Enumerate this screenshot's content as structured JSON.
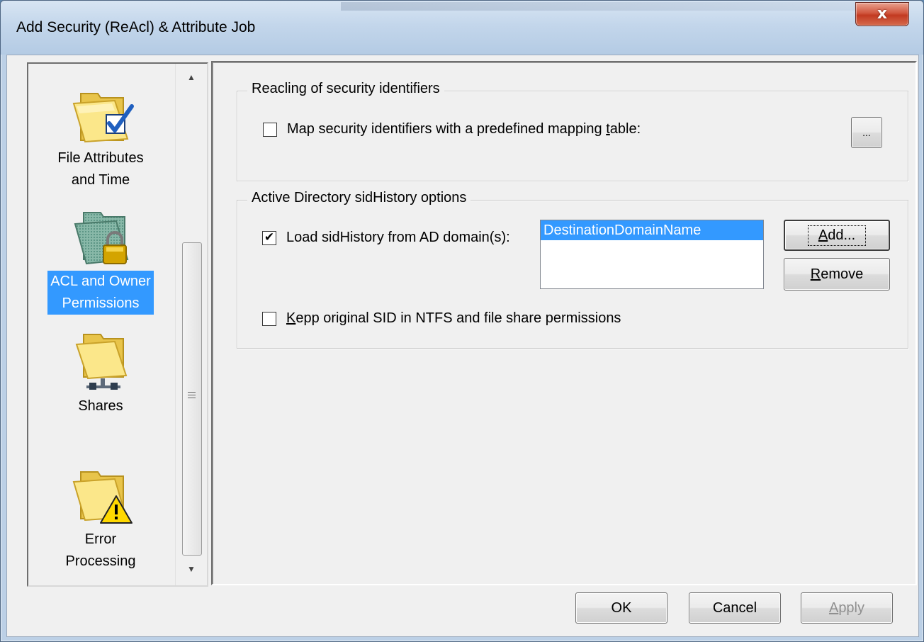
{
  "window": {
    "title": "Add Security (ReAcl) & Attribute Job",
    "close_glyph": "x"
  },
  "nav": {
    "items": [
      {
        "line1": "File Attributes",
        "line2": "and Time",
        "icon": "folder-check-icon",
        "selected": false
      },
      {
        "line1": "ACL and Owner",
        "line2": "Permissions",
        "icon": "folder-lock-icon",
        "selected": true
      },
      {
        "line1": "Shares",
        "line2": "",
        "icon": "folder-share-icon",
        "selected": false
      },
      {
        "line1": "Error",
        "line2": "Processing",
        "icon": "folder-warning-icon",
        "selected": false
      }
    ],
    "scroll_up_glyph": "▲",
    "scroll_down_glyph": "▼"
  },
  "reacl_group": {
    "legend": "Reacling of security identifiers",
    "map_checkbox": {
      "label_pre": "Map security identifiers with a predefined mapping ",
      "label_ul": "t",
      "label_post": "able:",
      "checked": false
    },
    "browse_label": "..."
  },
  "ad_group": {
    "legend": "Active Directory sidHistory options",
    "load_checkbox": {
      "label": "Load sidHistory from AD domain(s):",
      "checked": true,
      "mark": "✔"
    },
    "domains": [
      "DestinationDomainName"
    ],
    "add_button": {
      "ul": "A",
      "rest": "dd..."
    },
    "remove_button": {
      "ul": "R",
      "rest": "emove"
    },
    "keep_checkbox": {
      "ul": "K",
      "rest": "epp original SID in NTFS and file share permissions",
      "checked": false
    }
  },
  "footer": {
    "ok_label": "OK",
    "cancel_label": "Cancel",
    "apply_ul": "A",
    "apply_rest": "pply"
  },
  "colors": {
    "selection": "#3399ff",
    "folder": "#f5d85c",
    "check": "#1f5fbf",
    "warning": "#ffd800"
  }
}
